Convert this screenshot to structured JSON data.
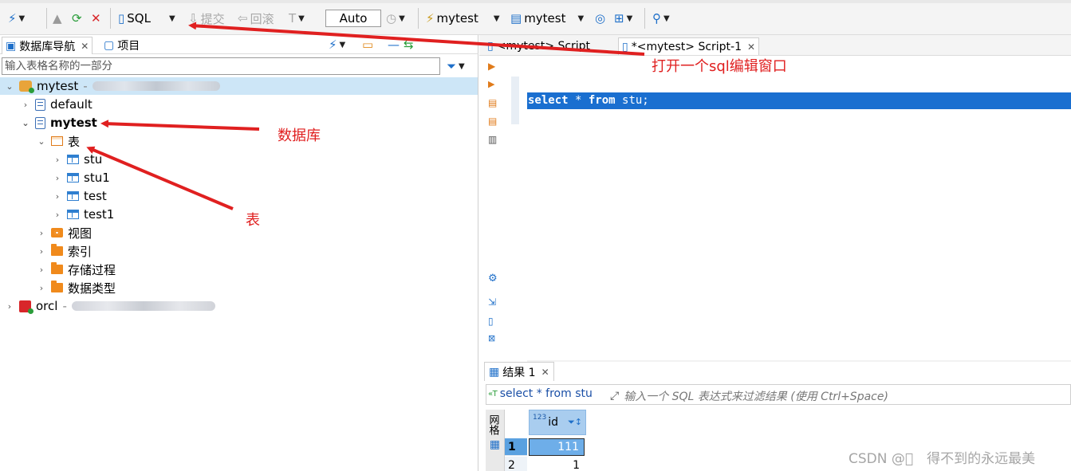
{
  "toolbar": {
    "sql_label": "SQL",
    "commit_label": "提交",
    "rollback_label": "回滚",
    "mode_label": "Auto",
    "connection_label": "mytest",
    "schema_label": "mytest"
  },
  "left_panel": {
    "tabs": [
      {
        "label": "数据库导航"
      },
      {
        "label": "项目"
      }
    ],
    "filter_placeholder": "输入表格名称的一部分",
    "tree": {
      "connection_1": "mytest",
      "connection_1_suffix": "-",
      "db_default": "default",
      "db_mytest": "mytest",
      "tables_folder": "表",
      "tables": [
        "stu",
        "stu1",
        "test",
        "test1"
      ],
      "views_folder": "视图",
      "index_folder": "索引",
      "procedure_folder": "存储过程",
      "datatype_folder": "数据类型",
      "connection_2": "orcl",
      "connection_2_suffix": "-"
    }
  },
  "editor": {
    "tabs": [
      {
        "label": "<mytest> Script"
      },
      {
        "label": "*<mytest> Script-1"
      }
    ],
    "code_keyword_select": "select",
    "code_star": " * ",
    "code_keyword_from": "from",
    "code_rest": " stu;"
  },
  "results": {
    "tab_label": "结果 1",
    "query_text": "select * from stu",
    "filter_placeholder": "输入一个 SQL 表达式来过滤结果 (使用 Ctrl+Space)",
    "side_label": "网格",
    "column_type": "123",
    "column_name": "id",
    "rows": [
      {
        "num": "1",
        "id": "111"
      },
      {
        "num": "2",
        "id": "1"
      }
    ]
  },
  "annotations": {
    "sql_window": "打开一个sql编辑窗口",
    "database": "数据库",
    "table": "表"
  },
  "watermark": "CSDN @\u0000　得不到的永远最美",
  "colors": {
    "annotation_red": "#e02020",
    "selection_blue": "#1a6fd0",
    "tree_selection": "#cde6f7"
  }
}
